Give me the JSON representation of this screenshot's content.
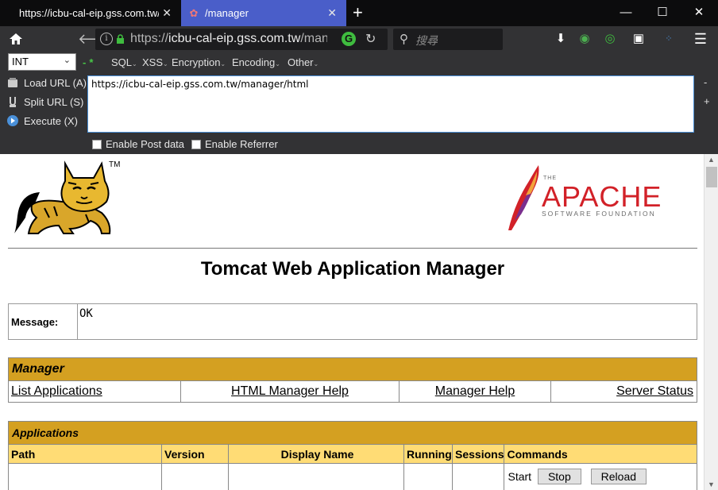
{
  "browser": {
    "tabs": [
      {
        "label": "https://icbu-cal-eip.gss.com.tw/"
      },
      {
        "label": "/manager"
      }
    ],
    "url_prefix": "https://",
    "url_domain": "icbu-cal-eip.gss.com.tw",
    "url_path": "/manag",
    "search_placeholder": "搜尋"
  },
  "hackbar": {
    "encoding_select": "INT",
    "menus": [
      "SQL",
      "XSS",
      "Encryption",
      "Encoding",
      "Other"
    ],
    "load_url": "Load URL (A)",
    "split_url": "Split URL (S)",
    "execute": "Execute (X)",
    "url_value": "https://icbu-cal-eip.gss.com.tw/manager/html",
    "enable_post": "Enable Post data",
    "enable_referrer": "Enable Referrer",
    "minus": "-",
    "plus": "+"
  },
  "page": {
    "tm": "TM",
    "apache_the": "THE",
    "apache_name": "APACHE",
    "apache_sub": "SOFTWARE FOUNDATION",
    "title": "Tomcat Web Application Manager",
    "message_label": "Message:",
    "message_value": "OK",
    "manager_heading": "Manager",
    "manager_links": [
      "List Applications",
      "HTML Manager Help",
      "Manager Help",
      "Server Status"
    ],
    "applications_heading": "Applications",
    "columns": [
      "Path",
      "Version",
      "Display Name",
      "Running",
      "Sessions",
      "Commands"
    ],
    "commands": {
      "start": "Start",
      "stop": "Stop",
      "reload": "Reload"
    }
  },
  "colors": {
    "section_header": "#d4a021",
    "column_header": "#ffdc75",
    "active_tab": "#4a5ec9",
    "apache_red": "#d22128"
  }
}
